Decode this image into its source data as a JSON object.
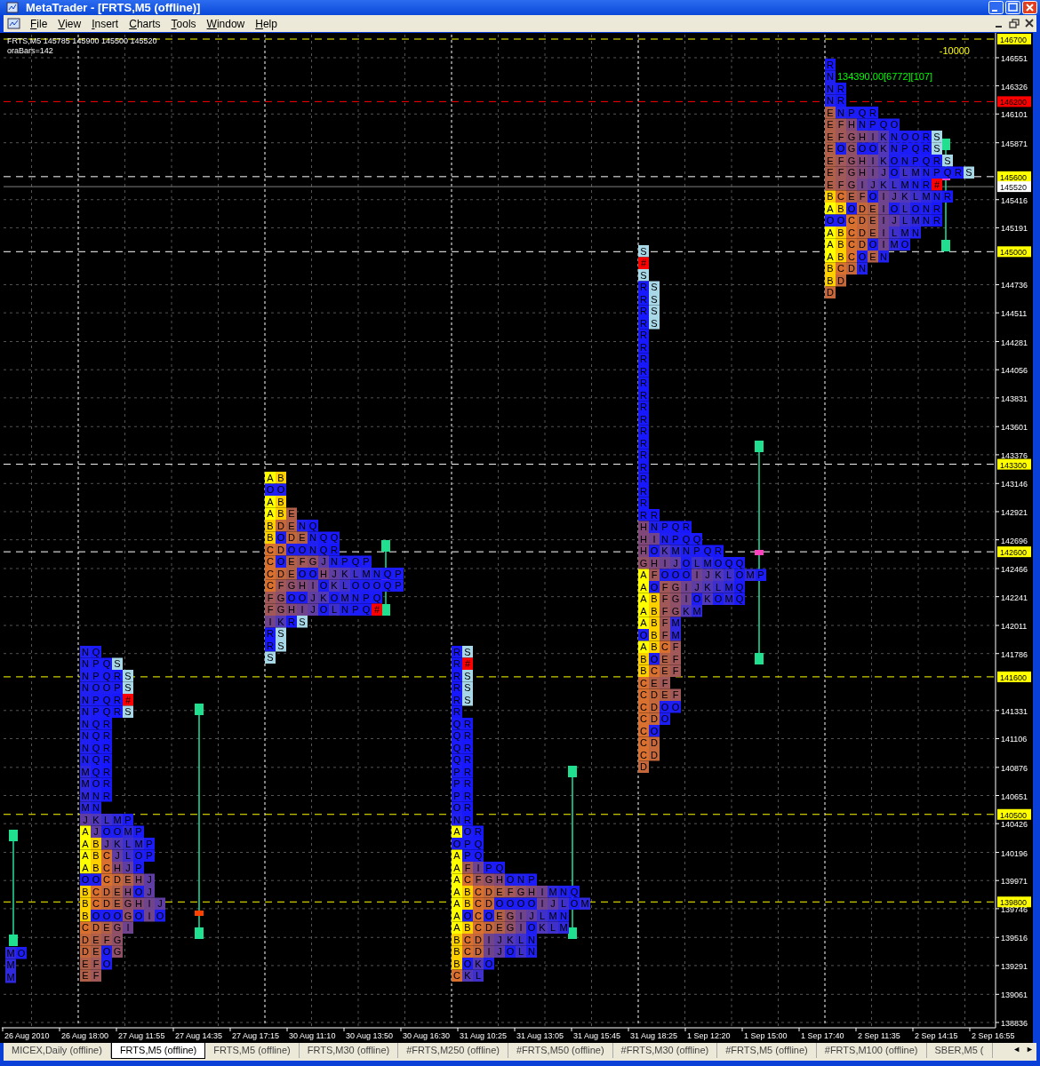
{
  "window": {
    "title": "MetaTrader - [FRTS,M5 (offline)]"
  },
  "menu": [
    "File",
    "View",
    "Insert",
    "Charts",
    "Tools",
    "Window",
    "Help"
  ],
  "chart": {
    "header": "FRTS,M5  145785 145900 145500 145520",
    "info": "oraBars=142",
    "indicator_value": "-10000",
    "price_ticks": [
      "146551",
      "146326",
      "146101",
      "145871",
      "145416",
      "145191",
      "144736",
      "144511",
      "144281",
      "144056",
      "143831",
      "143601",
      "143376",
      "143146",
      "142921",
      "142696",
      "142466",
      "142241",
      "142011",
      "141786",
      "141331",
      "141106",
      "140876",
      "140651",
      "140426",
      "140196",
      "139971",
      "139746",
      "139516",
      "139291",
      "139061",
      "138836"
    ],
    "price_lines": [
      {
        "label": "146700",
        "color": "#ffff00",
        "kind": "level"
      },
      {
        "label": "146200",
        "color": "#ff0000",
        "kind": "level"
      },
      {
        "label": "145600",
        "color": "#ffff00",
        "kind": "marker"
      },
      {
        "label": "145520",
        "color": "#ffffff",
        "kind": "current"
      },
      {
        "label": "145000",
        "color": "#ffff00",
        "kind": "marker"
      },
      {
        "label": "143300",
        "color": "#ffff00",
        "kind": "marker"
      },
      {
        "label": "142600",
        "color": "#ffff00",
        "kind": "marker"
      },
      {
        "label": "141600",
        "color": "#ffff00",
        "kind": "level"
      },
      {
        "label": "140500",
        "color": "#ffff00",
        "kind": "level"
      },
      {
        "label": "139800",
        "color": "#ffff00",
        "kind": "level"
      }
    ],
    "time_labels": [
      "26 Aug 2010",
      "26 Aug 18:00",
      "27 Aug 11:55",
      "27 Aug 14:35",
      "27 Aug 17:15",
      "30 Aug 11:10",
      "30 Aug 13:50",
      "30 Aug 16:30",
      "31 Aug 10:25",
      "31 Aug 13:05",
      "31 Aug 15:45",
      "31 Aug 18:25",
      "1 Sep 12:20",
      "1 Sep 15:00",
      "1 Sep 17:40",
      "2 Sep 11:35",
      "2 Sep 14:15",
      "2 Sep 16:55"
    ],
    "profiles": [
      {
        "rows": [
          "MO",
          "M",
          "M"
        ]
      },
      {
        "rows": [
          "NQ",
          "NPQS",
          "NPQRS",
          "NOOPS",
          "NPQR#",
          "NPQRS",
          "NQR",
          "NQR",
          "NQR",
          "NQR",
          "MQR",
          "MOR",
          "MNR",
          "MN",
          "JKLMP",
          "AJOOMP",
          "ABJKLMP",
          "ABCJLOP",
          "ABCHJP",
          "OOCDEHJ",
          "BCDEHOJ",
          "BCDEGHIJ",
          "BOOOGOIO",
          "CDEGI",
          "DEFG",
          "DEOG",
          "EFO",
          "EF"
        ]
      },
      {
        "rows": [
          "AB",
          "OO",
          "AB",
          "ABE",
          "BDENQ",
          "BODENQQ",
          "CDOONQR",
          "COEFGJNPQP",
          "CDEOOHJKLMNQP",
          "CFGHIOKLOOOQP",
          "FGOOJKOMNPQ",
          "FGHIJOLNPQ#",
          "IKRS",
          "RS",
          "RS",
          "S"
        ]
      },
      {
        "rows": [
          "RS",
          "R#",
          "RS",
          "RS",
          "RS",
          "R",
          "QR",
          "QR",
          "QR",
          "QR",
          "PR",
          "PR",
          "PR",
          "OR",
          "NR",
          "AOR",
          "OPQ",
          "APQ",
          "AFIPQ",
          "ACFGHONP",
          "ABCDEFGHIMNQ",
          "ABCDOOOOIJLOM",
          "AOCOEGIJLMN",
          "ABCDEGIOKLM",
          "BCDIJKLN",
          "BCDIJOLN",
          "BOKO",
          "CKL"
        ]
      },
      {
        "rows": [
          "S",
          "#",
          "S",
          "RS",
          "RS",
          "RS",
          "RS",
          "R",
          "R",
          "R",
          "R",
          "R",
          "R",
          "R",
          "R",
          "R",
          "R",
          "R",
          "R",
          "R",
          "R",
          "R",
          "RR",
          "HNPQR",
          "HINPQQ",
          "HOKMNPQR",
          "GHIJOLMOQQ",
          "AFOOOIJKLOMP",
          "AOFGIJKLMQ",
          "ABFGIOKOMQ",
          "ABFGKM",
          "ABFM",
          "OBFM",
          "ABCF",
          "BOEF",
          "BCEF",
          "CEF",
          "CDEF",
          "CDOO",
          "CDO",
          "CO",
          "CD",
          "CD",
          "D"
        ]
      },
      {
        "note": "134390.00[6772][107]",
        "rows": [
          "R",
          "N",
          "NR",
          "NR",
          "ENPQR",
          "EFHNPQO",
          "EFGHIKNOORS",
          "EOGOOKNPQRS",
          "EFGHIKONPQRS",
          "EFGHIJOLMNPQRS",
          "EFGIJKLMNR#",
          "BCEFOIJKLMNR",
          "ABODEIOLONR",
          "OOCDEIJLMNR",
          "ABCDEILMN",
          "ABCDOIMO",
          "ABCOEN",
          "BCDN",
          "BD",
          "D"
        ]
      }
    ]
  },
  "tabs": [
    {
      "label": "MICEX,Daily (offline)",
      "selected": false
    },
    {
      "label": "FRTS,M5 (offline)",
      "selected": true
    },
    {
      "label": "FRTS,M5 (offline)",
      "selected": false
    },
    {
      "label": "FRTS,M30 (offline)",
      "selected": false
    },
    {
      "label": "#FRTS,M250 (offline)",
      "selected": false
    },
    {
      "label": "#FRTS,M50 (offline)",
      "selected": false
    },
    {
      "label": "#FRTS,M30 (offline)",
      "selected": false
    },
    {
      "label": "#FRTS,M5 (offline)",
      "selected": false
    },
    {
      "label": "#FRTS,M100 (offline)",
      "selected": false
    },
    {
      "label": "SBER,M5 (",
      "selected": false
    }
  ],
  "tab_scroll": [
    "◄",
    "►"
  ]
}
